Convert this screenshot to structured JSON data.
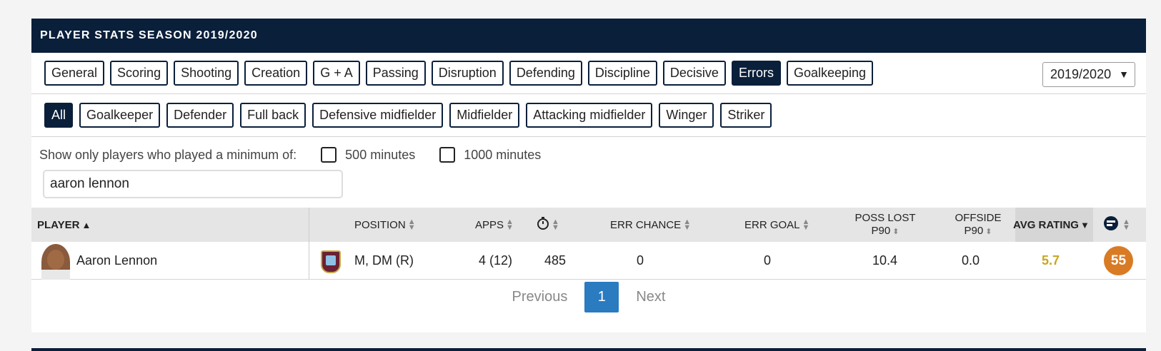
{
  "header": {
    "title": "PLAYER STATS SEASON 2019/2020"
  },
  "stat_tabs": [
    {
      "label": "General",
      "active": false
    },
    {
      "label": "Scoring",
      "active": false
    },
    {
      "label": "Shooting",
      "active": false
    },
    {
      "label": "Creation",
      "active": false
    },
    {
      "label": "G + A",
      "active": false
    },
    {
      "label": "Passing",
      "active": false
    },
    {
      "label": "Disruption",
      "active": false
    },
    {
      "label": "Defending",
      "active": false
    },
    {
      "label": "Discipline",
      "active": false
    },
    {
      "label": "Decisive",
      "active": false
    },
    {
      "label": "Errors",
      "active": true
    },
    {
      "label": "Goalkeeping",
      "active": false
    }
  ],
  "season_select": {
    "value": "2019/2020",
    "arrow": "▼"
  },
  "position_tabs": [
    {
      "label": "All",
      "active": true
    },
    {
      "label": "Goalkeeper",
      "active": false
    },
    {
      "label": "Defender",
      "active": false
    },
    {
      "label": "Full back",
      "active": false
    },
    {
      "label": "Defensive midfielder",
      "active": false
    },
    {
      "label": "Midfielder",
      "active": false
    },
    {
      "label": "Attacking midfielder",
      "active": false
    },
    {
      "label": "Winger",
      "active": false
    },
    {
      "label": "Striker",
      "active": false
    }
  ],
  "filter": {
    "label": "Show only players who played a minimum of:",
    "option_500": "500 minutes",
    "option_1000": "1000 minutes"
  },
  "search": {
    "value": "aaron lennon"
  },
  "columns": {
    "player": "PLAYER",
    "position": "POSITION",
    "apps": "APPS",
    "err_chance": "ERR CHANCE",
    "err_goal": "ERR GOAL",
    "poss_lost_1": "POSS LOST",
    "poss_lost_2": "P90",
    "offside_1": "OFFSIDE",
    "offside_2": "P90",
    "avg_rating": "AVG RATING"
  },
  "row": {
    "name": "Aaron Lennon",
    "position": "M, DM (R)",
    "apps": "4 (12)",
    "minutes": "485",
    "err_chance": "0",
    "err_goal": "0",
    "poss_lost": "10.4",
    "offside": "0.0",
    "avg_rating": "5.7",
    "score": "55"
  },
  "pager": {
    "previous": "Previous",
    "page": "1",
    "next": "Next"
  },
  "colors": {
    "navy": "#0a1f3a",
    "rating": "#c9a620",
    "badge": "#d97b25",
    "page": "#2a7bc0"
  }
}
